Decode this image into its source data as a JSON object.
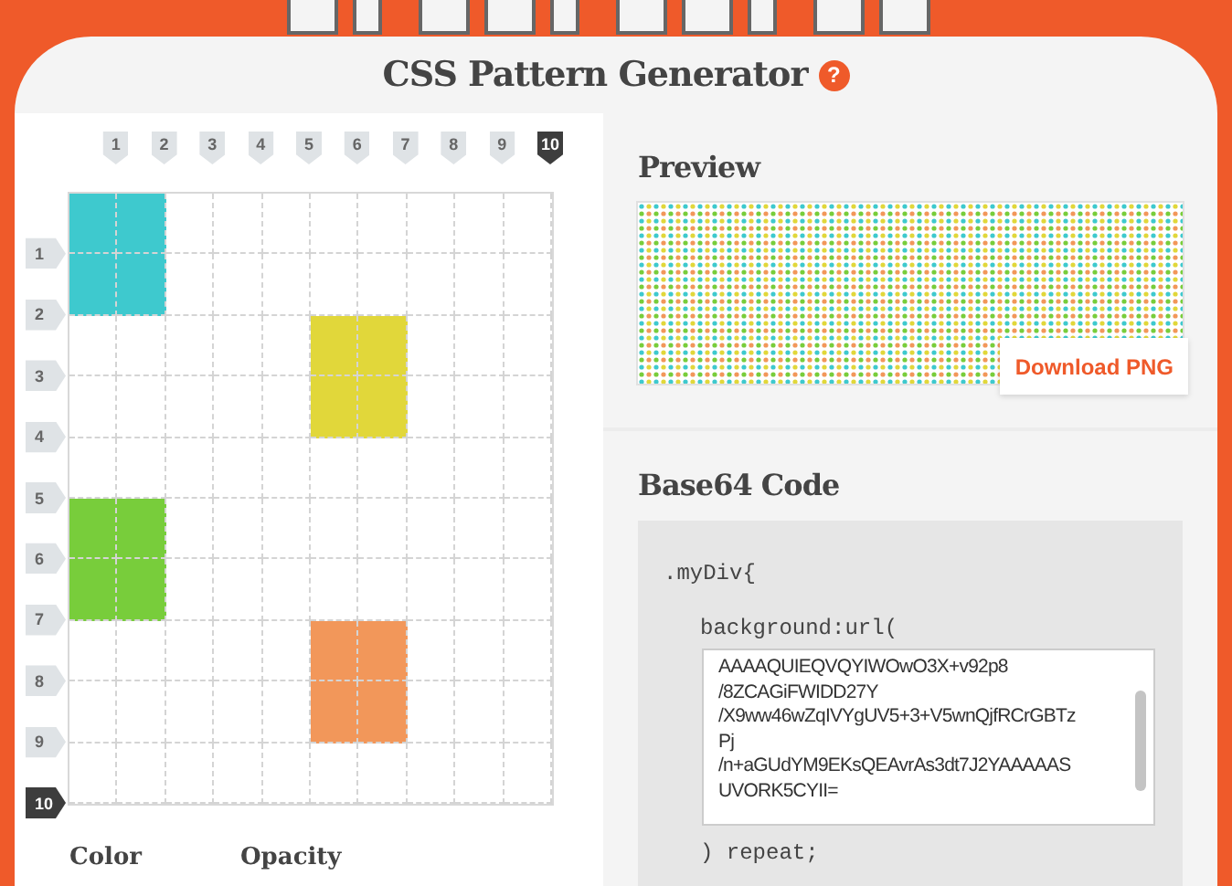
{
  "header": {
    "title": "CSS Pattern Generator",
    "help": "?"
  },
  "editor": {
    "columns": [
      {
        "label": "1",
        "selected": false
      },
      {
        "label": "2",
        "selected": false
      },
      {
        "label": "3",
        "selected": false
      },
      {
        "label": "4",
        "selected": false
      },
      {
        "label": "5",
        "selected": false
      },
      {
        "label": "6",
        "selected": false
      },
      {
        "label": "7",
        "selected": false
      },
      {
        "label": "8",
        "selected": false
      },
      {
        "label": "9",
        "selected": false
      },
      {
        "label": "10",
        "selected": true
      }
    ],
    "rows": [
      {
        "label": "1",
        "selected": false
      },
      {
        "label": "2",
        "selected": false
      },
      {
        "label": "3",
        "selected": false
      },
      {
        "label": "4",
        "selected": false
      },
      {
        "label": "5",
        "selected": false
      },
      {
        "label": "6",
        "selected": false
      },
      {
        "label": "7",
        "selected": false
      },
      {
        "label": "8",
        "selected": false
      },
      {
        "label": "9",
        "selected": false
      },
      {
        "label": "10",
        "selected": true
      }
    ],
    "grid": [
      [
        {
          "filled": true,
          "color": "#3ec9ce"
        },
        {
          "filled": true,
          "color": "#3ec9ce"
        },
        {
          "filled": false
        },
        {
          "filled": false
        },
        {
          "filled": false
        },
        {
          "filled": false
        },
        {
          "filled": false
        },
        {
          "filled": false
        },
        {
          "filled": false
        },
        {
          "filled": false
        }
      ],
      [
        {
          "filled": true,
          "color": "#3ec9ce"
        },
        {
          "filled": true,
          "color": "#3ec9ce"
        },
        {
          "filled": false
        },
        {
          "filled": false
        },
        {
          "filled": false
        },
        {
          "filled": false
        },
        {
          "filled": false
        },
        {
          "filled": false
        },
        {
          "filled": false
        },
        {
          "filled": false
        }
      ],
      [
        {
          "filled": false
        },
        {
          "filled": false
        },
        {
          "filled": false
        },
        {
          "filled": false
        },
        {
          "filled": false
        },
        {
          "filled": true,
          "color": "#e1d73a"
        },
        {
          "filled": true,
          "color": "#e1d73a"
        },
        {
          "filled": false
        },
        {
          "filled": false
        },
        {
          "filled": false
        }
      ],
      [
        {
          "filled": false
        },
        {
          "filled": false
        },
        {
          "filled": false
        },
        {
          "filled": false
        },
        {
          "filled": false
        },
        {
          "filled": true,
          "color": "#e1d73a"
        },
        {
          "filled": true,
          "color": "#e1d73a"
        },
        {
          "filled": false
        },
        {
          "filled": false
        },
        {
          "filled": false
        }
      ],
      [
        {
          "filled": false
        },
        {
          "filled": false
        },
        {
          "filled": false
        },
        {
          "filled": false
        },
        {
          "filled": false
        },
        {
          "filled": false
        },
        {
          "filled": false
        },
        {
          "filled": false
        },
        {
          "filled": false
        },
        {
          "filled": false
        }
      ],
      [
        {
          "filled": true,
          "color": "#78cd3b"
        },
        {
          "filled": true,
          "color": "#78cd3b"
        },
        {
          "filled": false
        },
        {
          "filled": false
        },
        {
          "filled": false
        },
        {
          "filled": false
        },
        {
          "filled": false
        },
        {
          "filled": false
        },
        {
          "filled": false
        },
        {
          "filled": false
        }
      ],
      [
        {
          "filled": true,
          "color": "#78cd3b"
        },
        {
          "filled": true,
          "color": "#78cd3b"
        },
        {
          "filled": false
        },
        {
          "filled": false
        },
        {
          "filled": false
        },
        {
          "filled": false
        },
        {
          "filled": false
        },
        {
          "filled": false
        },
        {
          "filled": false
        },
        {
          "filled": false
        }
      ],
      [
        {
          "filled": false
        },
        {
          "filled": false
        },
        {
          "filled": false
        },
        {
          "filled": false
        },
        {
          "filled": false
        },
        {
          "filled": true,
          "color": "#f2975a"
        },
        {
          "filled": true,
          "color": "#f2975a"
        },
        {
          "filled": false
        },
        {
          "filled": false
        },
        {
          "filled": false
        }
      ],
      [
        {
          "filled": false
        },
        {
          "filled": false
        },
        {
          "filled": false
        },
        {
          "filled": false
        },
        {
          "filled": false
        },
        {
          "filled": true,
          "color": "#f2975a"
        },
        {
          "filled": true,
          "color": "#f2975a"
        },
        {
          "filled": false
        },
        {
          "filled": false
        },
        {
          "filled": false
        }
      ],
      [
        {
          "filled": false
        },
        {
          "filled": false
        },
        {
          "filled": false
        },
        {
          "filled": false
        },
        {
          "filled": false
        },
        {
          "filled": false
        },
        {
          "filled": false
        },
        {
          "filled": false
        },
        {
          "filled": false
        },
        {
          "filled": false
        }
      ]
    ],
    "controls": [
      "Color",
      "Opacity"
    ]
  },
  "preview": {
    "heading": "Preview",
    "button": "Download PNG"
  },
  "code": {
    "heading": "Base64 Code",
    "lines_before": [
      ".myDiv{",
      "background:url("
    ],
    "value_lines": [
      "AAAAQUIEQVQYIWOwO3X+v92p8",
      "/8ZCAGiFWIDD27Y",
      "/X9ww46wZqIVYgUV5+3+V5wnQjfRCrGBTz",
      "Pj",
      "/n+aGUdYM9EKsQEAvrAs3dt7J2YAAAAAS",
      "UVORK5CYII="
    ],
    "line_after": ") repeat;"
  }
}
